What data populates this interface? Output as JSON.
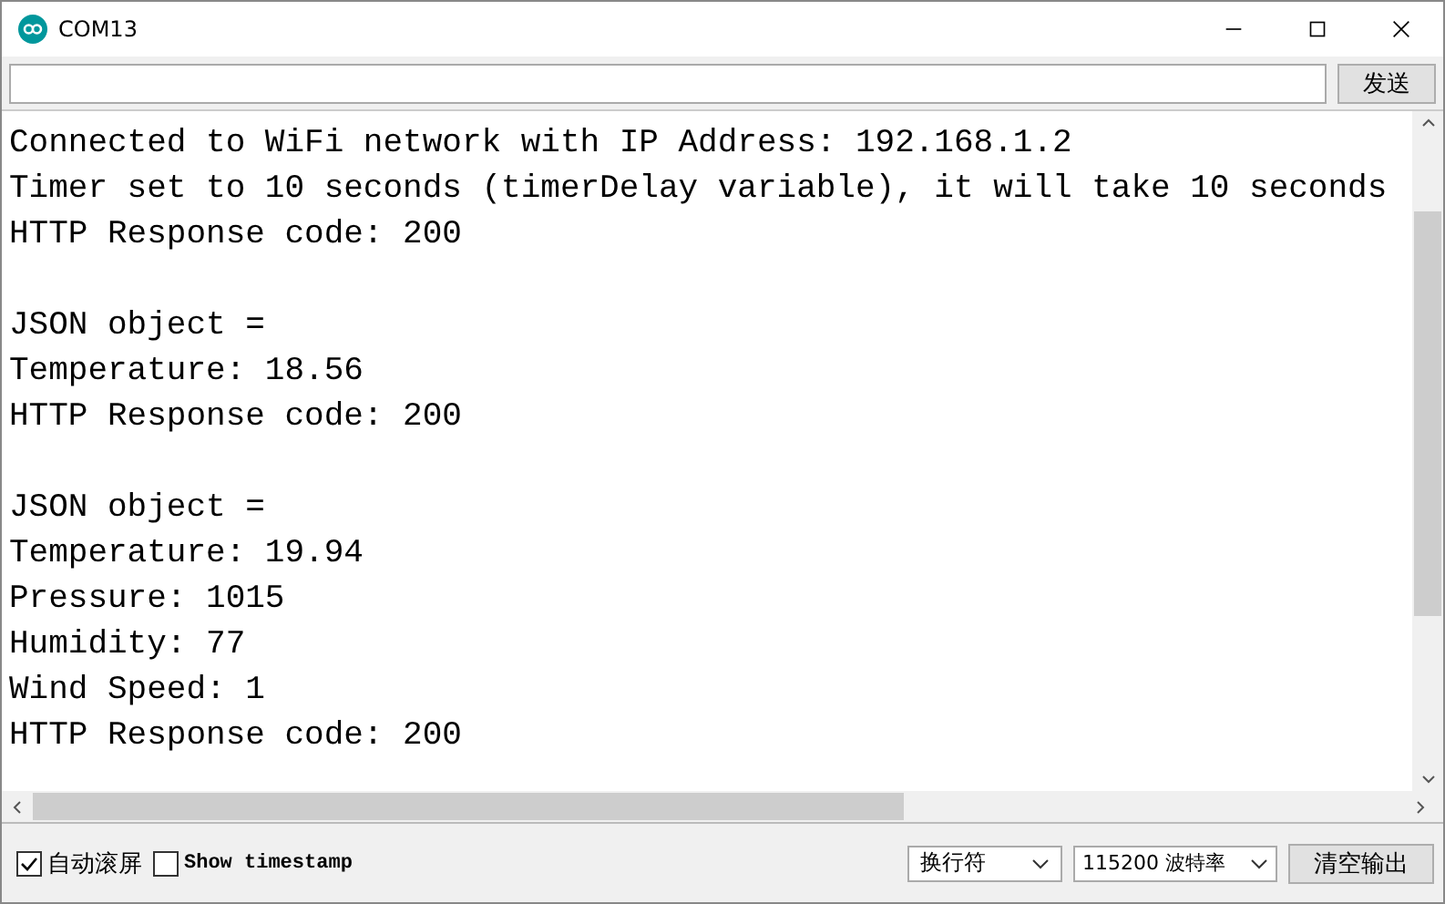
{
  "window": {
    "title": "COM13"
  },
  "send": {
    "button": "发送"
  },
  "output": {
    "lines": [
      {
        "kind": "text",
        "text": "Connected to WiFi network with IP Address: 192.168.1.2"
      },
      {
        "kind": "text",
        "text": "Timer set to 10 seconds (timerDelay variable), it will take 10 seconds"
      },
      {
        "kind": "text",
        "text": "HTTP Response code: 200"
      },
      {
        "kind": "blank"
      },
      {
        "kind": "text",
        "text": "JSON object ="
      },
      {
        "kind": "text",
        "text": "Temperature: 18.56"
      },
      {
        "kind": "text",
        "text": "HTTP Response code: 200"
      },
      {
        "kind": "blank"
      },
      {
        "kind": "text",
        "text": "JSON object ="
      },
      {
        "kind": "text",
        "text": "Temperature: 19.94"
      },
      {
        "kind": "text",
        "text": "Pressure: 1015"
      },
      {
        "kind": "text",
        "text": "Humidity: 77"
      },
      {
        "kind": "text",
        "text": "Wind Speed: 1"
      },
      {
        "kind": "text",
        "text": "HTTP Response code: 200"
      }
    ]
  },
  "footer": {
    "autoscroll": {
      "label": "自动滚屏",
      "checked": true
    },
    "timestamp": {
      "label": "Show timestamp",
      "checked": false
    },
    "line_ending": "换行符",
    "baud": "115200 波特率",
    "clear_button": "清空输出"
  }
}
